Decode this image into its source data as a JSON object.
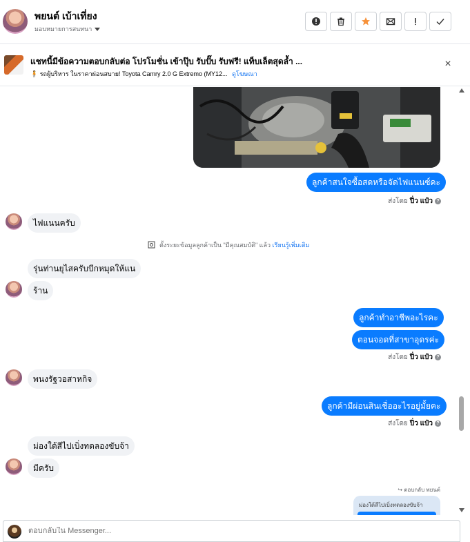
{
  "header": {
    "name": "พยนต์ เบ้าเที่ยง",
    "assign_label": "มอบหมายการสนทนา",
    "actions": [
      {
        "name": "spam-button",
        "icon": "alert-circle-icon"
      },
      {
        "name": "delete-button",
        "icon": "trash-icon"
      },
      {
        "name": "star-button",
        "icon": "star-icon"
      },
      {
        "name": "mark-unread-button",
        "icon": "mail-icon"
      },
      {
        "name": "follow-up-button",
        "icon": "exclamation-icon"
      },
      {
        "name": "mark-done-button",
        "icon": "check-icon"
      }
    ]
  },
  "promo": {
    "title": "แชทนี้มีข้อความตอบกลับต่อ โปรโมชั่น เข้าปุ๊บ รับปั๊บ รับฟรี! แท็บเล็ตสุดล้ำ ...",
    "subtitle": "🧍 รถผู้บริหาร ในราคาผ่อนสบาย! Toyota Camry 2.0 G Extremo (MY12...",
    "link": "ดูโฆษณา"
  },
  "messages": {
    "m1": "ลูกค้าสนใจซื้อสดหรือจัดไฟแนนซ์คะ",
    "sent_by_prefix": "ส่งโดย",
    "agent_name": "ปิ่ว แป๋ว",
    "m2": "ไฟแนนครับ",
    "system_note": "ตั้งระยะข้อมูลลูกค้าเป็น \"มีคุณสมบัติ\" แล้ว",
    "system_link": "เรียนรู้เพิ่มเติม",
    "m3": "รุ่นท่านยุไสครับบีกหมุดให้แน",
    "m4": "ร้าน",
    "m5": "ลูกค้าทำอาชีพอะไรคะ",
    "m6": "ตอนจอดที่สาขาอุดรค่ะ",
    "m7": "พนงรัฐวอสาหกิจ",
    "m8": "ลูกค้ามีผ่อนสินเชื่ออะไรอยู่มั้ยคะ",
    "m9": "ม่องใด้สีไปเบิ่งทดลองขับจ้า",
    "m10": "มีครับ",
    "reply_hint": "ตอบกลับ พยนต์",
    "reply_quote": "ม่องใด้สีไปเบิ่งทดลองขับจ้า"
  },
  "composer": {
    "placeholder": "ตอบกลับใน Messenger..."
  },
  "colors": {
    "outgoing_bubble": "#0a7cff",
    "incoming_bubble": "#f0f2f5",
    "star_accent": "#f7923a"
  }
}
